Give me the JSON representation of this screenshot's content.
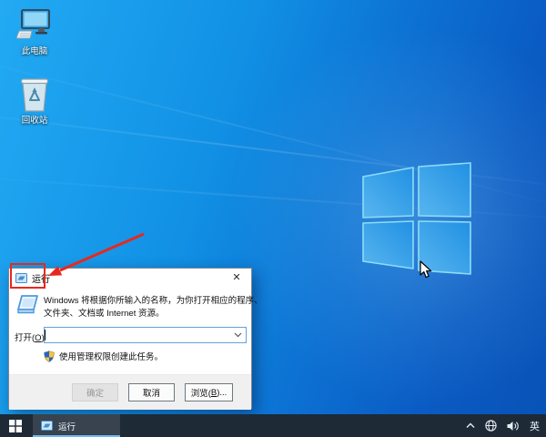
{
  "wallpaper": {
    "colors": {
      "left": "#22aaf3",
      "right": "#0852b6",
      "logo_fill_light": "#58b6ef",
      "logo_fill_dark": "#2190e3",
      "logo_stroke": "#8ddcf8"
    }
  },
  "desktop_icons": [
    {
      "id": "this-pc",
      "label": "此电脑"
    },
    {
      "id": "recycle-bin",
      "label": "回收站"
    }
  ],
  "run_dialog": {
    "title": "运行",
    "close_glyph": "✕",
    "description": {
      "line1": "Windows 将根据你所输入的名称，为你打开相应的程序、",
      "line2": "文件夹、文档或 Internet 资源。"
    },
    "open_label": {
      "prefix": "打开(",
      "mnemonic": "O",
      "suffix": "):"
    },
    "input": {
      "value": ""
    },
    "uac_note": "使用管理权限创建此任务。",
    "buttons": {
      "ok": "确定",
      "cancel": "取消",
      "browse": {
        "prefix": "浏览(",
        "mnemonic": "B",
        "suffix": ")..."
      }
    }
  },
  "annotations": {
    "highlight_color": "#e8281e"
  },
  "taskbar": {
    "app": {
      "label": "运行"
    },
    "tray": {
      "ime": "英"
    }
  }
}
